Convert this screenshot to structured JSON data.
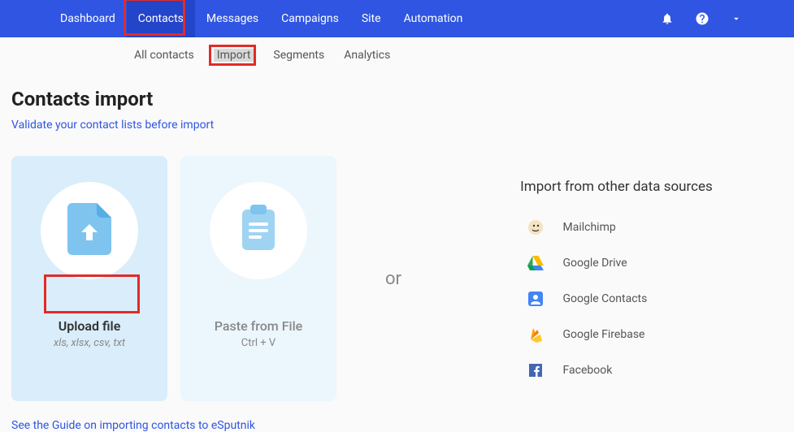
{
  "nav": {
    "items": [
      "Dashboard",
      "Contacts",
      "Messages",
      "Campaigns",
      "Site",
      "Automation"
    ],
    "active_index": 1
  },
  "subnav": {
    "items": [
      "All contacts",
      "Import",
      "Segments",
      "Analytics"
    ],
    "active_index": 1
  },
  "page": {
    "title": "Contacts import",
    "validate_link": "Validate your contact lists before import",
    "guide_link": "See the Guide on importing contacts to eSputnik"
  },
  "cards": {
    "upload": {
      "title": "Upload file",
      "sub": "xls, xlsx, csv, txt"
    },
    "paste": {
      "title": "Paste from File",
      "sub": "Ctrl + V"
    }
  },
  "or_text": "or",
  "sources": {
    "title": "Import from other data sources",
    "items": [
      "Mailchimp",
      "Google Drive",
      "Google Contacts",
      "Google Firebase",
      "Facebook"
    ]
  }
}
